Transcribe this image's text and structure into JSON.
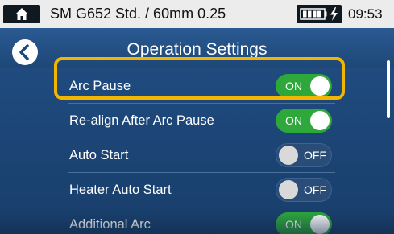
{
  "status_bar": {
    "title": "SM G652 Std. / 60mm 0.25",
    "time": "09:53"
  },
  "header": {
    "title": "Operation Settings"
  },
  "settings": [
    {
      "label": "Arc Pause",
      "state": "ON"
    },
    {
      "label": "Re-align After Arc Pause",
      "state": "ON"
    },
    {
      "label": "Auto Start",
      "state": "OFF"
    },
    {
      "label": "Heater Auto Start",
      "state": "OFF"
    },
    {
      "label": "Additional Arc",
      "state": "ON"
    }
  ],
  "colors": {
    "toggle_on": "#2ea83b",
    "highlight": "#f2b600",
    "background": "#1b3f6b"
  },
  "icons": [
    "home-icon",
    "battery-icon",
    "charging-icon",
    "back-arrow-icon"
  ]
}
